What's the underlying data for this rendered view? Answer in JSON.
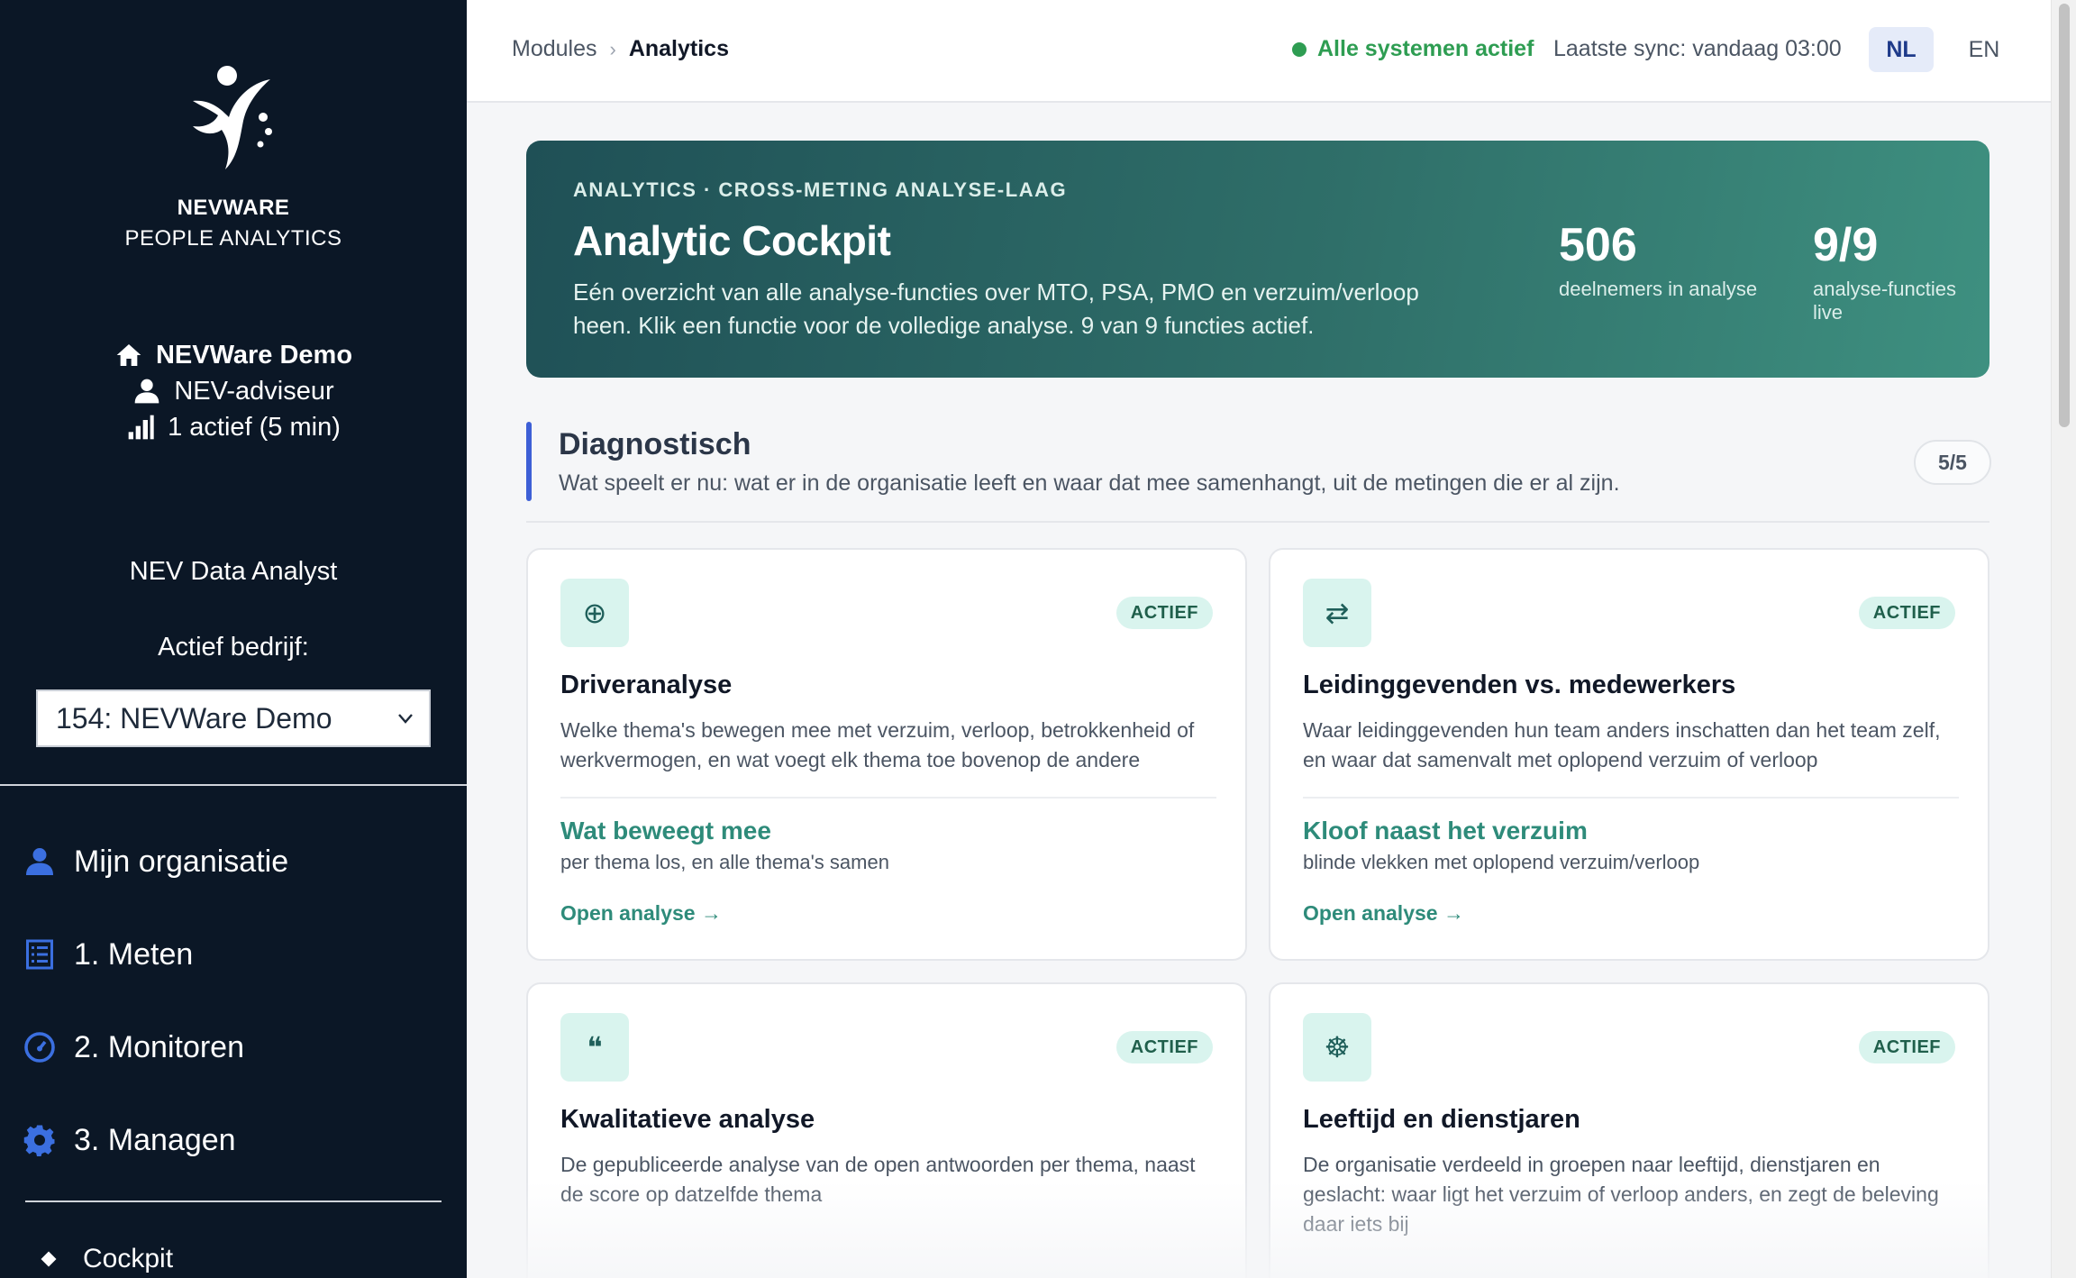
{
  "brand": {
    "name": "NEVWARE",
    "sub": "PEOPLE ANALYTICS"
  },
  "user": {
    "org": "NEVWare Demo",
    "role": "NEV-adviseur",
    "active": "1 actief (5 min)"
  },
  "sidebar": {
    "analyst_title": "NEV Data Analyst",
    "active_company_label": "Actief bedrijf:",
    "company_selected": "154: NEVWare Demo",
    "nav": [
      {
        "label": "Mijn organisatie",
        "icon": "user-icon"
      },
      {
        "label": "1. Meten",
        "icon": "list-icon"
      },
      {
        "label": "2. Monitoren",
        "icon": "gauge-icon"
      },
      {
        "label": "3. Managen",
        "icon": "gear-icon"
      }
    ],
    "subnav": {
      "label": "Cockpit"
    }
  },
  "header": {
    "breadcrumb_root": "Modules",
    "breadcrumb_current": "Analytics",
    "status": "Alle systemen actief",
    "sync": "Laatste sync: vandaag 03:00",
    "lang_nl": "NL",
    "lang_en": "EN"
  },
  "hero": {
    "eyebrow": "ANALYTICS · CROSS-METING ANALYSE-LAAG",
    "title": "Analytic Cockpit",
    "description": "Eén overzicht van alle analyse-functies over MTO, PSA, PMO en verzuim/verloop heen. Klik een functie voor de volledige analyse. 9 van 9 functies actief.",
    "stat1_value": "506",
    "stat1_label": "deelnemers in analyse",
    "stat2_value": "9/9",
    "stat2_label": "analyse-functies live"
  },
  "section": {
    "title": "Diagnostisch",
    "subtitle": "Wat speelt er nu: wat er in de organisatie leeft en waar dat mee samenhangt, uit de metingen die er al zijn.",
    "count": "5/5"
  },
  "cards": [
    {
      "icon_glyph": "⊕",
      "badge": "ACTIEF",
      "title": "Driveranalyse",
      "description": "Welke thema's bewegen mee met verzuim, verloop, betrokkenheid of werkvermogen, en wat voegt elk thema toe bovenop de andere",
      "highlight": "Wat beweegt mee",
      "highlight_sub": "per thema los, en alle thema's samen",
      "link": "Open analyse →"
    },
    {
      "icon_glyph": "⇄",
      "badge": "ACTIEF",
      "title": "Leidinggevenden vs. medewerkers",
      "description": "Waar leidinggevenden hun team anders inschatten dan het team zelf, en waar dat samenvalt met oplopend verzuim of verloop",
      "highlight": "Kloof naast het verzuim",
      "highlight_sub": "blinde vlekken met oplopend verzuim/verloop",
      "link": "Open analyse →"
    },
    {
      "icon_glyph": "❝",
      "badge": "ACTIEF",
      "title": "Kwalitatieve analyse",
      "description": "De gepubliceerde analyse van de open antwoorden per thema, naast de score op datzelfde thema"
    },
    {
      "icon_glyph": "☸",
      "badge": "ACTIEF",
      "title": "Leeftijd en dienstjaren",
      "description": "De organisatie verdeeld in groepen naar leeftijd, dienstjaren en geslacht: waar ligt het verzuim of verloop anders, en zegt de beleving daar iets bij"
    }
  ]
}
